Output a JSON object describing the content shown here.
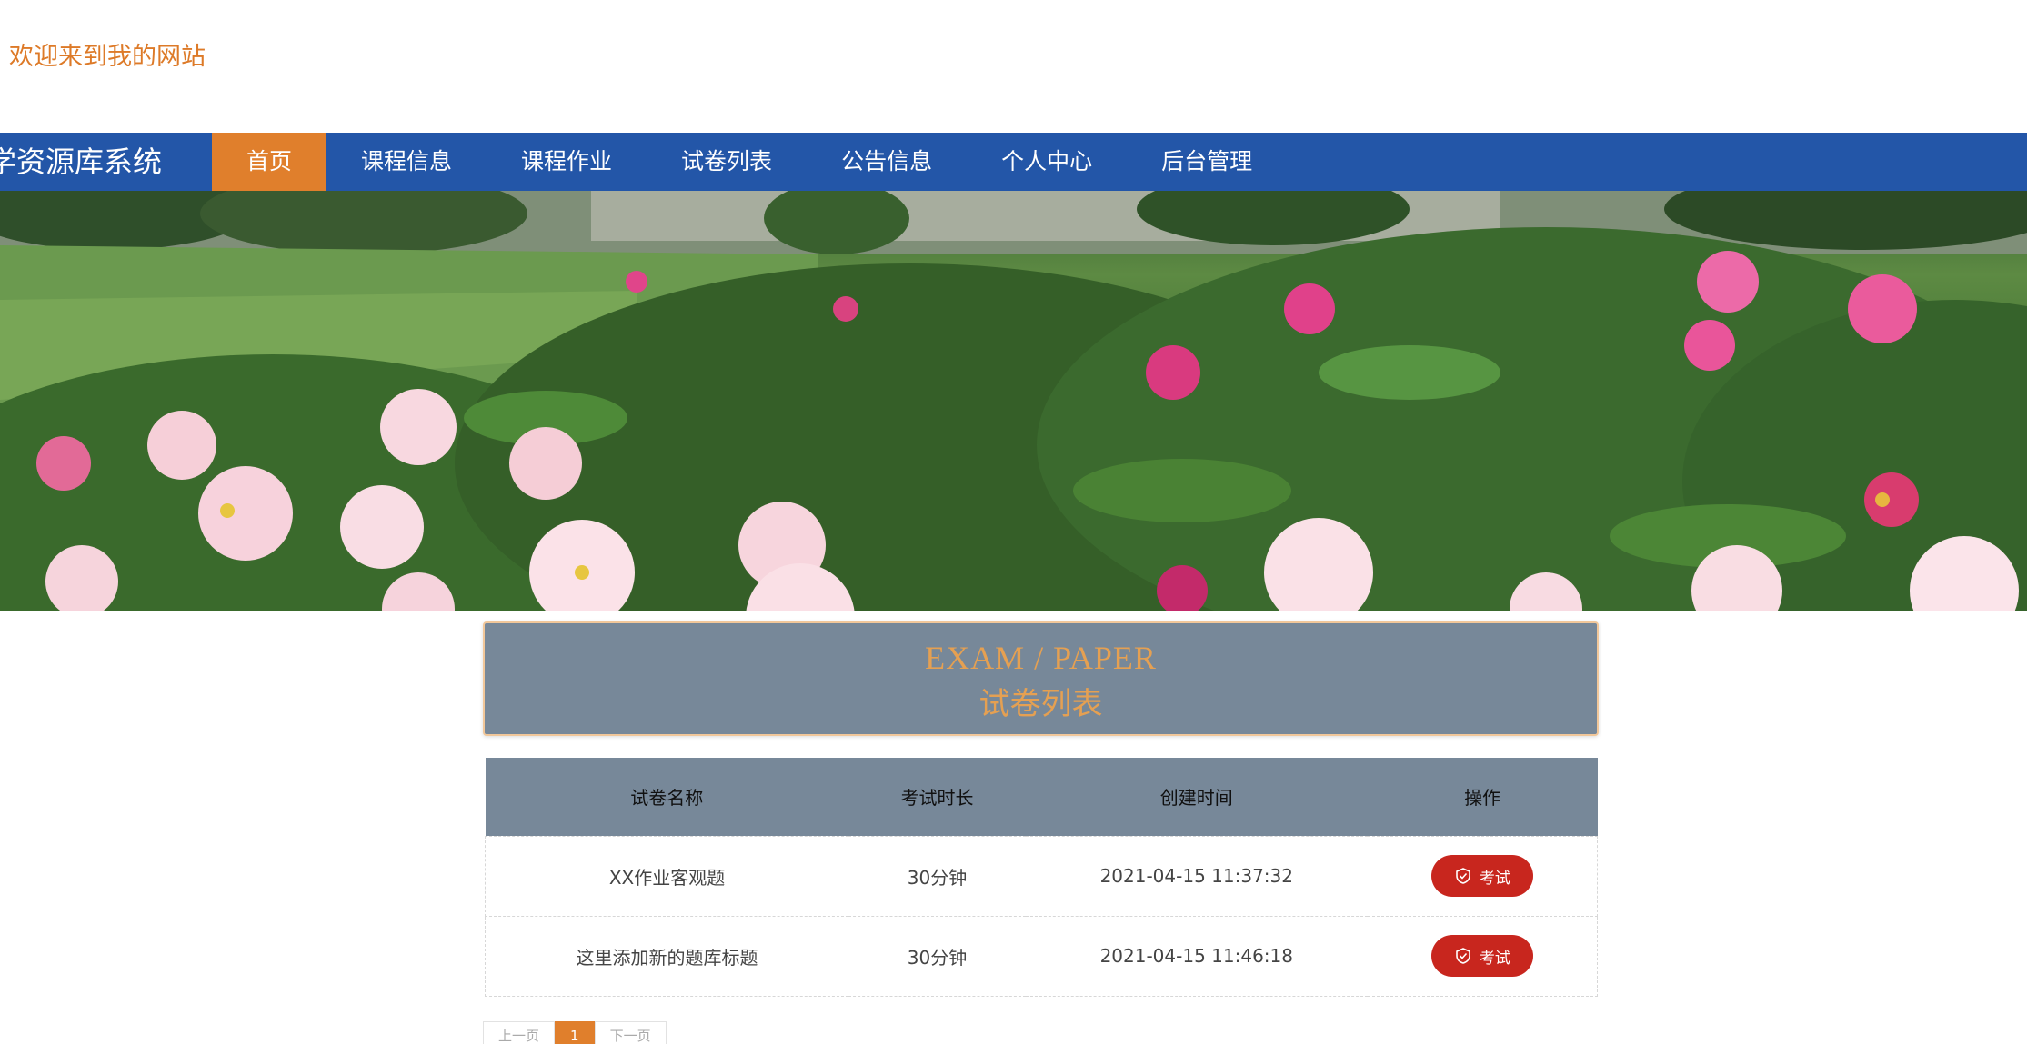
{
  "header": {
    "welcome": "欢迎来到我的网站"
  },
  "nav": {
    "brand": "学资源库系统",
    "items": [
      {
        "label": "首页",
        "active": true
      },
      {
        "label": "课程信息"
      },
      {
        "label": "课程作业"
      },
      {
        "label": "试卷列表"
      },
      {
        "label": "公告信息"
      },
      {
        "label": "个人中心"
      },
      {
        "label": "后台管理"
      }
    ]
  },
  "banner": {
    "slides": 3,
    "active_slide": 1
  },
  "section": {
    "title_en": "EXAM / PAPER",
    "title_zh": "试卷列表"
  },
  "table": {
    "headers": [
      "试卷名称",
      "考试时长",
      "创建时间",
      "操作"
    ],
    "rows": [
      {
        "name": "XX作业客观题",
        "duration": "30分钟",
        "created": "2021-04-15 11:37:32",
        "action": "考试"
      },
      {
        "name": "这里添加新的题库标题",
        "duration": "30分钟",
        "created": "2021-04-15 11:46:18",
        "action": "考试"
      }
    ]
  },
  "pagination": {
    "prev": "上一页",
    "current": "1",
    "next": "下一页"
  },
  "colors": {
    "nav_bg": "#2356a8",
    "accent": "#e07f2c",
    "panel_bg": "#778899",
    "title_text": "#e5a052",
    "button_red": "#c8261e"
  },
  "icons": {
    "exam_button": "shield-check-icon"
  }
}
